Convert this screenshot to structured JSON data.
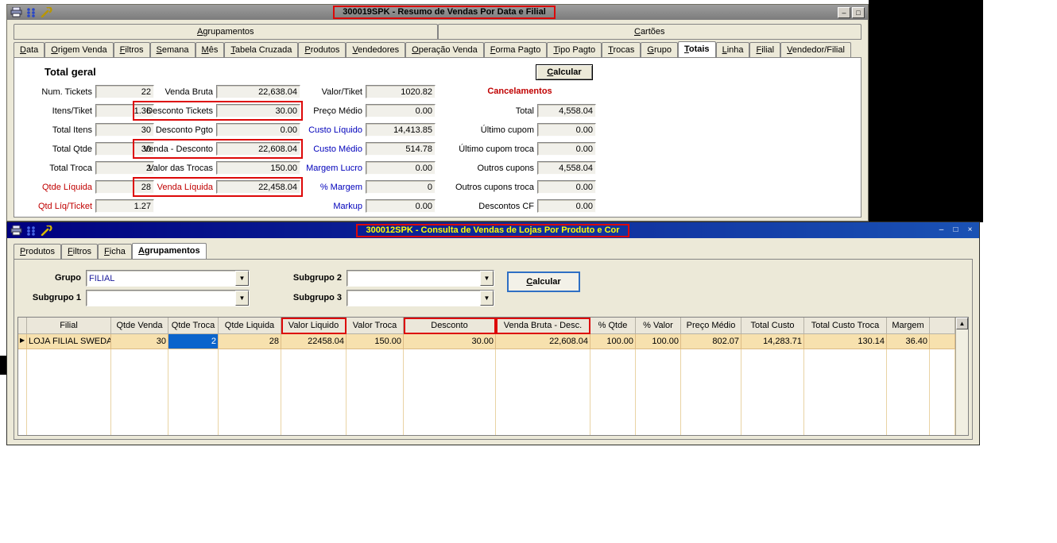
{
  "colors": {
    "annotation_red": "#dd0808",
    "titlebar_inactive_gray": "#808080",
    "titlebar_active_navy": "#000080",
    "active_title_text": "#ffff00",
    "grid_row_highlight": "#f7e1ae",
    "selected_cell_blue": "#0a64cc",
    "label_blue": "#0000bb",
    "label_red": "#c00000"
  },
  "glyphs": {
    "dropdown": "▼",
    "scroll_up": "▲",
    "row_marker": "▶"
  },
  "window1": {
    "title": "300019SPK - Resumo de Vendas Por Data e Filial",
    "controls": {
      "minimize": "–",
      "maximize": "□"
    },
    "icons": [
      "printer-icon",
      "database-icon",
      "wrench-icon"
    ],
    "tab_groups": [
      "Agrupamentos",
      "Cartões"
    ],
    "tabs": [
      "Data",
      "Origem Venda",
      "Filtros",
      "Semana",
      "Mês",
      "Tabela Cruzada",
      "Produtos",
      "Vendedores",
      "Operação Venda",
      "Forma Pagto",
      "Tipo Pagto",
      "Trocas",
      "Grupo",
      "Totais",
      "Linha",
      "Filial",
      "Vendedor/Filial"
    ],
    "active_tab": "Totais",
    "section_title": "Total geral",
    "calc_button": "Calcular",
    "col1": [
      {
        "label": "Num. Tickets",
        "value": "22"
      },
      {
        "label": "Itens/Tiket",
        "value": "1.36"
      },
      {
        "label": "Total Itens",
        "value": "30"
      },
      {
        "label": "Total Qtde",
        "value": "30"
      },
      {
        "label": "Total Troca",
        "value": "2"
      },
      {
        "label": "Qtde Líquida",
        "value": "28"
      },
      {
        "label": "Qtd Líq/Ticket",
        "value": "1.27"
      }
    ],
    "col2": [
      {
        "label": "Venda Bruta",
        "value": "22,638.04"
      },
      {
        "label": "Desconto Tickets",
        "value": "30.00"
      },
      {
        "label": "Desconto Pgto",
        "value": "0.00"
      },
      {
        "label": "Venda - Desconto",
        "value": "22,608.04"
      },
      {
        "label": "Valor das Trocas",
        "value": "150.00"
      },
      {
        "label": "Venda Líquida",
        "value": "22,458.04"
      }
    ],
    "col3": [
      {
        "label": "Valor/Tiket",
        "value": "1020.82"
      },
      {
        "label": "Preço Médio",
        "value": "0.00"
      },
      {
        "label": "Custo Líquido",
        "value": "14,413.85"
      },
      {
        "label": "Custo Médio",
        "value": "514.78"
      },
      {
        "label": "Margem Lucro",
        "value": "0.00"
      },
      {
        "label": "% Margem",
        "value": "0"
      },
      {
        "label": "Markup",
        "value": "0.00"
      }
    ],
    "cancel_title": "Cancelamentos",
    "col4": [
      {
        "label": "Total",
        "value": "4,558.04"
      },
      {
        "label": "Último cupom",
        "value": "0.00"
      },
      {
        "label": "Último cupom troca",
        "value": "0.00"
      },
      {
        "label": "Outros cupons",
        "value": "4,558.04"
      },
      {
        "label": "Outros cupons troca",
        "value": "0.00"
      },
      {
        "label": "Descontos CF",
        "value": "0.00"
      }
    ]
  },
  "window2": {
    "title": "300012SPK - Consulta de Vendas de Lojas Por Produto e Cor",
    "controls": {
      "minimize": "–",
      "maximize": "□",
      "close": "×"
    },
    "tabs": [
      "Produtos",
      "Filtros",
      "Ficha",
      "Agrupamentos"
    ],
    "active_tab": "Agrupamentos",
    "form": {
      "grupo_label": "Grupo",
      "grupo_value": "FILIAL",
      "subgrupo1_label": "Subgrupo 1",
      "subgrupo1_value": "",
      "subgrupo2_label": "Subgrupo 2",
      "subgrupo2_value": "",
      "subgrupo3_label": "Subgrupo 3",
      "subgrupo3_value": "",
      "calc_button": "Calcular"
    },
    "grid": {
      "headers": [
        "Filial",
        "Qtde Venda",
        "Qtde Troca",
        "Qtde Liquida",
        "Valor Liquido",
        "Valor Troca",
        "Desconto",
        "Venda Bruta - Desc.",
        "% Qtde",
        "% Valor",
        "Preço Médio",
        "Total Custo",
        "Total Custo Troca",
        "Margem"
      ],
      "row": [
        "LOJA FILIAL SWEDA",
        "30",
        "2",
        "28",
        "22458.04",
        "150.00",
        "30.00",
        "22,608.04",
        "100.00",
        "100.00",
        "802.07",
        "14,283.71",
        "130.14",
        "36.40"
      ]
    }
  }
}
